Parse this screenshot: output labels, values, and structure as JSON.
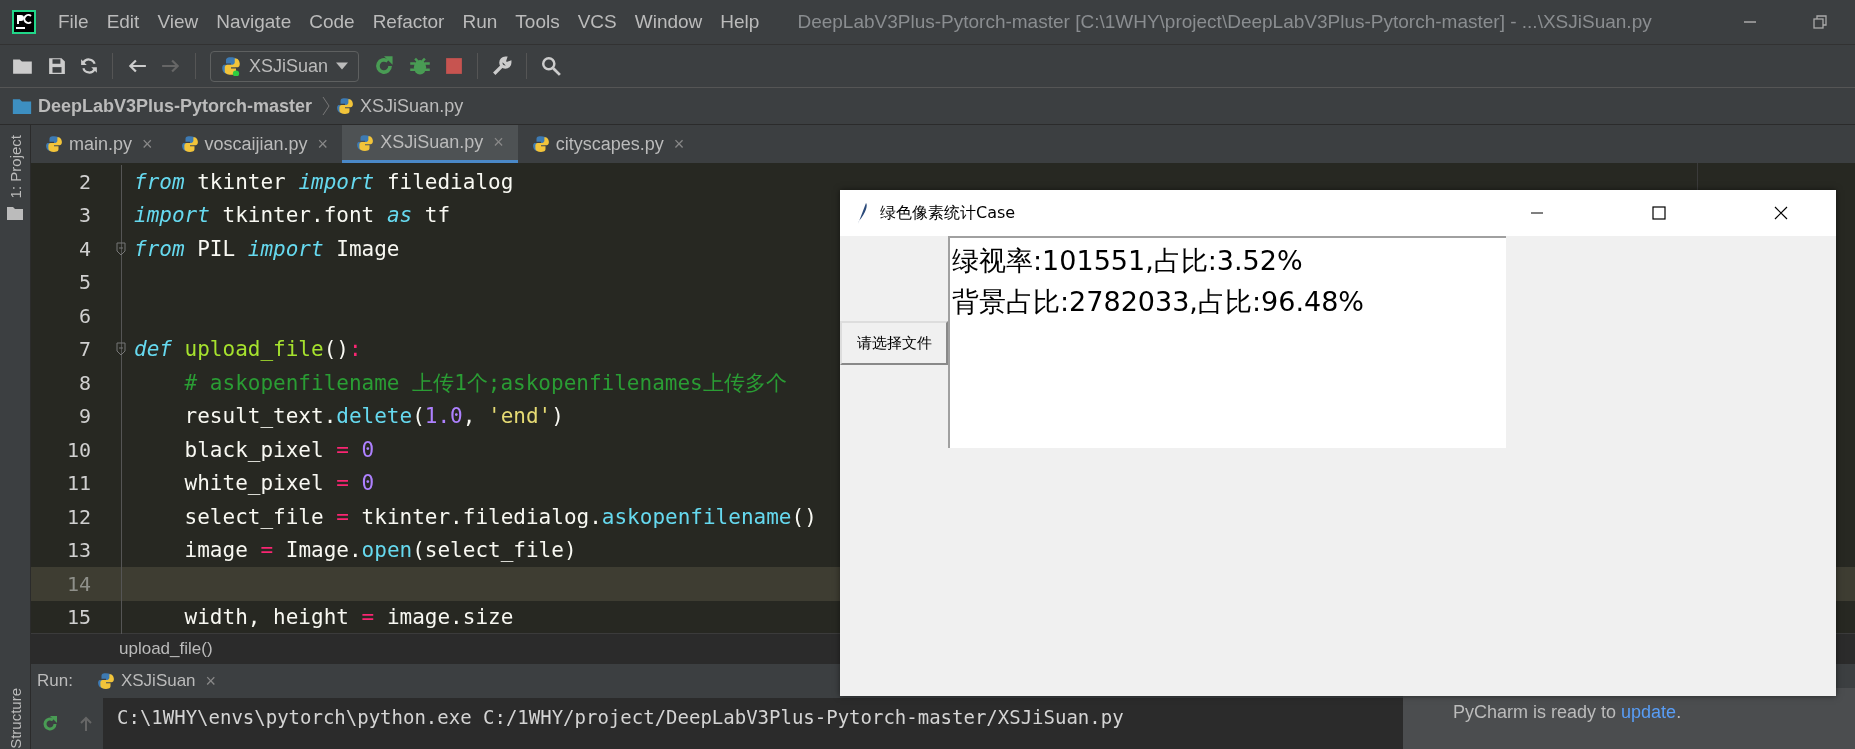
{
  "window": {
    "title": "DeepLabV3Plus-Pytorch-master [C:\\1WHY\\project\\DeepLabV3Plus-Pytorch-master] - ...\\XSJiSuan.py"
  },
  "menu": [
    "File",
    "Edit",
    "View",
    "Navigate",
    "Code",
    "Refactor",
    "Run",
    "Tools",
    "VCS",
    "Window",
    "Help"
  ],
  "toolbar": {
    "run_config": "XSJiSuan"
  },
  "breadcrumb": [
    "DeepLabV3Plus-Pytorch-master",
    "XSJiSuan.py"
  ],
  "side_tabs": [
    "1: Project",
    "Structure"
  ],
  "tabs": [
    {
      "label": "main.py",
      "selected": false,
      "close": "×"
    },
    {
      "label": "voscaijian.py",
      "selected": false,
      "close": "×"
    },
    {
      "label": "XSJiSuan.py",
      "selected": true,
      "close": "×"
    },
    {
      "label": "cityscapes.py",
      "selected": false,
      "close": "×"
    }
  ],
  "code": [
    {
      "number": "2",
      "current": false,
      "tokens": [
        {
          "kind": "keyword",
          "text": "from"
        },
        {
          "kind": "plain",
          "text": " tkinter "
        },
        {
          "kind": "keyword",
          "text": "import"
        },
        {
          "kind": "plain",
          "text": " filedialog"
        }
      ]
    },
    {
      "number": "3",
      "current": false,
      "tokens": [
        {
          "kind": "keyword",
          "text": "import"
        },
        {
          "kind": "plain",
          "text": " tkinter.font "
        },
        {
          "kind": "keyword",
          "text": "as"
        },
        {
          "kind": "plain",
          "text": " tf"
        }
      ]
    },
    {
      "number": "4",
      "current": false,
      "tokens": [
        {
          "kind": "keyword",
          "text": "from"
        },
        {
          "kind": "plain",
          "text": " PIL "
        },
        {
          "kind": "keyword",
          "text": "import"
        },
        {
          "kind": "plain",
          "text": " Image"
        }
      ]
    },
    {
      "number": "5",
      "current": false
    },
    {
      "number": "6",
      "current": false
    },
    {
      "number": "7",
      "current": false,
      "tokens": [
        {
          "kind": "keyword",
          "text": "def"
        },
        {
          "kind": "function",
          "text": " upload_file"
        },
        {
          "kind": "plain",
          "text": "()"
        },
        {
          "kind": "operator",
          "text": ":"
        }
      ]
    },
    {
      "number": "8",
      "current": false,
      "tokens": [
        {
          "kind": "comment",
          "text": "    # askopenfilename 上传1个;askopenfilenames上传多个"
        }
      ]
    },
    {
      "number": "9",
      "current": false,
      "tokens": [
        {
          "kind": "plain",
          "text": "    result_text."
        },
        {
          "kind": "method",
          "text": "delete"
        },
        {
          "kind": "plain",
          "text": "("
        },
        {
          "kind": "number",
          "text": "1.0"
        },
        {
          "kind": "plain",
          "text": ", "
        },
        {
          "kind": "string",
          "text": "'end'"
        },
        {
          "kind": "plain",
          "text": ")"
        }
      ]
    },
    {
      "number": "10",
      "current": false,
      "tokens": [
        {
          "kind": "plain",
          "text": "    black_pixel "
        },
        {
          "kind": "operator",
          "text": "="
        },
        {
          "kind": "number",
          "text": " 0"
        }
      ]
    },
    {
      "number": "11",
      "current": false,
      "tokens": [
        {
          "kind": "plain",
          "text": "    white_pixel "
        },
        {
          "kind": "operator",
          "text": "="
        },
        {
          "kind": "number",
          "text": " 0"
        }
      ]
    },
    {
      "number": "12",
      "current": false,
      "tokens": [
        {
          "kind": "plain",
          "text": "    select_file "
        },
        {
          "kind": "operator",
          "text": "="
        },
        {
          "kind": "plain",
          "text": " tkinter.filedialog."
        },
        {
          "kind": "method",
          "text": "askopenfilename"
        },
        {
          "kind": "plain",
          "text": "()"
        }
      ]
    },
    {
      "number": "13",
      "current": false,
      "tokens": [
        {
          "kind": "plain",
          "text": "    image "
        },
        {
          "kind": "operator",
          "text": "="
        },
        {
          "kind": "plain",
          "text": " Image."
        },
        {
          "kind": "method",
          "text": "open"
        },
        {
          "kind": "plain",
          "text": "(select_file)"
        }
      ]
    },
    {
      "number": "14",
      "current": true
    },
    {
      "number": "15",
      "current": false,
      "tokens": [
        {
          "kind": "plain",
          "text": "    width, height "
        },
        {
          "kind": "operator",
          "text": "="
        },
        {
          "kind": "plain",
          "text": " image.size"
        }
      ]
    }
  ],
  "editor_breadcrumb": "upload_file()",
  "run_panel": {
    "label": "Run:",
    "tab": "XSJiSuan",
    "tab_close": "×",
    "output": "C:\\1WHY\\envs\\pytorch\\python.exe C:/1WHY/project/DeepLabV3Plus-Pytorch-master/XSJiSuan.py"
  },
  "notification": {
    "text": "PyCharm is ready to ",
    "link": "update",
    "end": "."
  },
  "app_window": {
    "title": "绿色像素统计Case",
    "button": "请选择文件",
    "result_lines": [
      "绿视率:101551,占比:3.52%",
      "背景占比:2782033,占比:96.48%"
    ]
  }
}
